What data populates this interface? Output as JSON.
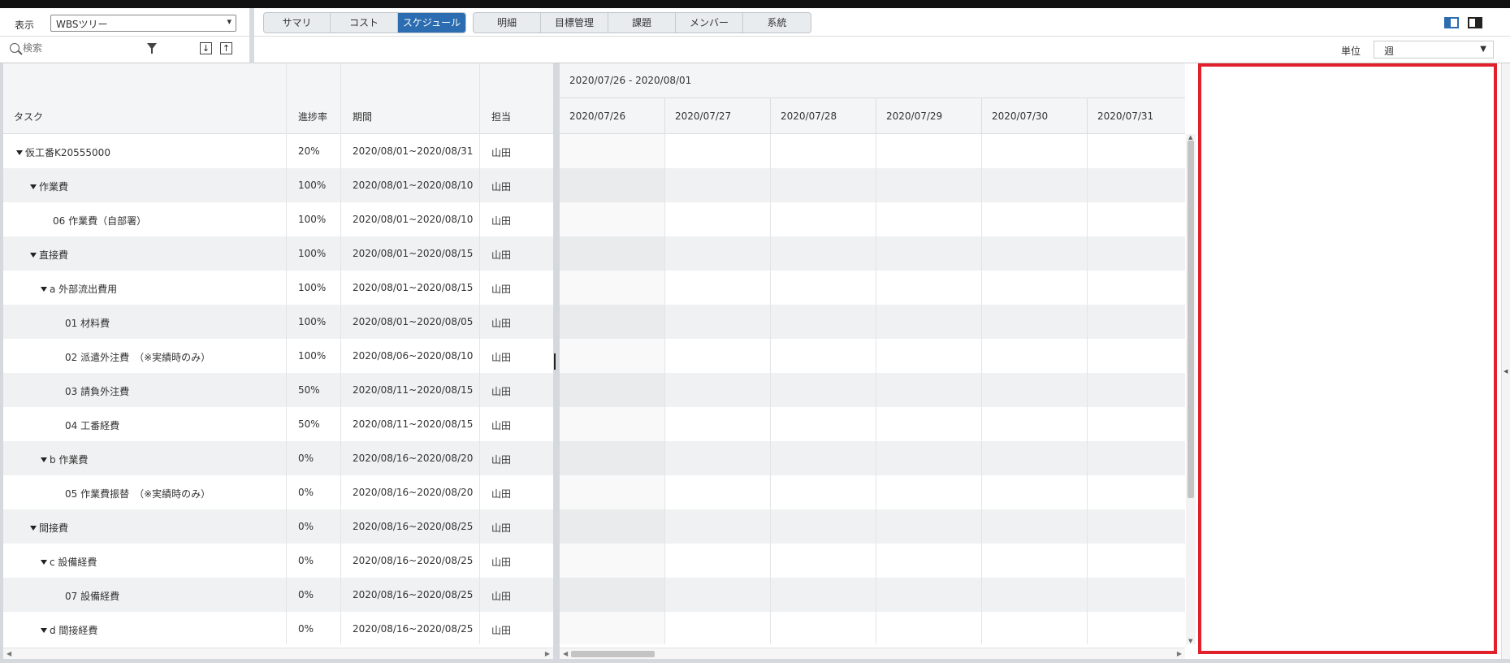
{
  "header": {
    "display_label": "表示",
    "display_select": "WBSツリー",
    "tabs_group1": [
      {
        "label": "サマリ",
        "active": false
      },
      {
        "label": "コスト",
        "active": false
      },
      {
        "label": "スケジュール",
        "active": true
      }
    ],
    "tabs_group2": [
      {
        "label": "明細"
      },
      {
        "label": "目標管理"
      },
      {
        "label": "課題"
      },
      {
        "label": "メンバー"
      },
      {
        "label": "系統"
      }
    ],
    "search_placeholder": "検索",
    "unit_label": "単位",
    "unit_value": "週"
  },
  "table": {
    "columns": {
      "task": "タスク",
      "progress": "進捗率",
      "period": "期間",
      "owner": "担当"
    },
    "rows": [
      {
        "task": "仮工番K20555000",
        "progress": "20%",
        "period": "2020/08/01~2020/08/31",
        "owner": "山田",
        "level": 0,
        "expandable": true
      },
      {
        "task": "作業費",
        "progress": "100%",
        "period": "2020/08/01~2020/08/10",
        "owner": "山田",
        "level": 1,
        "expandable": true
      },
      {
        "task": "06 作業費（自部署）",
        "progress": "100%",
        "period": "2020/08/01~2020/08/10",
        "owner": "山田",
        "level": 2,
        "expandable": false
      },
      {
        "task": "直接費",
        "progress": "100%",
        "period": "2020/08/01~2020/08/15",
        "owner": "山田",
        "level": 1,
        "expandable": true
      },
      {
        "task": "a 外部流出費用",
        "progress": "100%",
        "period": "2020/08/01~2020/08/15",
        "owner": "山田",
        "level": 2,
        "expandable": true
      },
      {
        "task": "01 材料費",
        "progress": "100%",
        "period": "2020/08/01~2020/08/05",
        "owner": "山田",
        "level": 3,
        "expandable": false
      },
      {
        "task": "02 派遣外注費　（※実績時のみ）",
        "progress": "100%",
        "period": "2020/08/06~2020/08/10",
        "owner": "山田",
        "level": 3,
        "expandable": false
      },
      {
        "task": "03 請負外注費",
        "progress": "50%",
        "period": "2020/08/11~2020/08/15",
        "owner": "山田",
        "level": 3,
        "expandable": false
      },
      {
        "task": "04 工番経費",
        "progress": "50%",
        "period": "2020/08/11~2020/08/15",
        "owner": "山田",
        "level": 3,
        "expandable": false
      },
      {
        "task": "b 作業費",
        "progress": "0%",
        "period": "2020/08/16~2020/08/20",
        "owner": "山田",
        "level": 2,
        "expandable": true
      },
      {
        "task": "05 作業費振替　（※実績時のみ）",
        "progress": "0%",
        "period": "2020/08/16~2020/08/20",
        "owner": "山田",
        "level": 3,
        "expandable": false
      },
      {
        "task": "間接費",
        "progress": "0%",
        "period": "2020/08/16~2020/08/25",
        "owner": "山田",
        "level": 1,
        "expandable": true
      },
      {
        "task": "c 設備経費",
        "progress": "0%",
        "period": "2020/08/16~2020/08/25",
        "owner": "山田",
        "level": 2,
        "expandable": true
      },
      {
        "task": "07 設備経費",
        "progress": "0%",
        "period": "2020/08/16~2020/08/25",
        "owner": "山田",
        "level": 3,
        "expandable": false
      },
      {
        "task": "d 間接経費",
        "progress": "0%",
        "period": "2020/08/16~2020/08/25",
        "owner": "山田",
        "level": 2,
        "expandable": true
      }
    ]
  },
  "gantt": {
    "week_range": "2020/07/26 - 2020/08/01",
    "days": [
      "2020/07/26",
      "2020/07/27",
      "2020/07/28",
      "2020/07/29",
      "2020/07/30",
      "2020/07/31"
    ]
  },
  "colors": {
    "accent": "#2c6cb0",
    "alt_row": "#f0f1f2",
    "panel_border": "#e0202b"
  }
}
